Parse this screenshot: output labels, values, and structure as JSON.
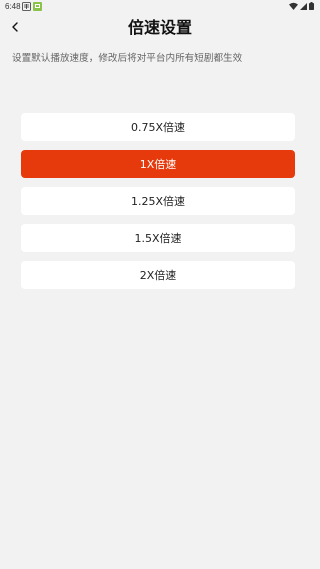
{
  "status_bar": {
    "time": "6:48",
    "app_icon_glyph": "撤"
  },
  "header": {
    "title": "倍速设置",
    "back_icon": "chevron-left-icon"
  },
  "hint": "设置默认播放速度，修改后将对平台内所有短剧都生效",
  "speed_options": [
    {
      "label": "0.75X倍速",
      "selected": false
    },
    {
      "label": "1X倍速",
      "selected": true
    },
    {
      "label": "1.25X倍速",
      "selected": false
    },
    {
      "label": "1.5X倍速",
      "selected": false
    },
    {
      "label": "2X倍速",
      "selected": false
    }
  ],
  "colors": {
    "background": "#f2f2f2",
    "selected_bg": "#e73a0c",
    "option_bg": "#ffffff"
  }
}
